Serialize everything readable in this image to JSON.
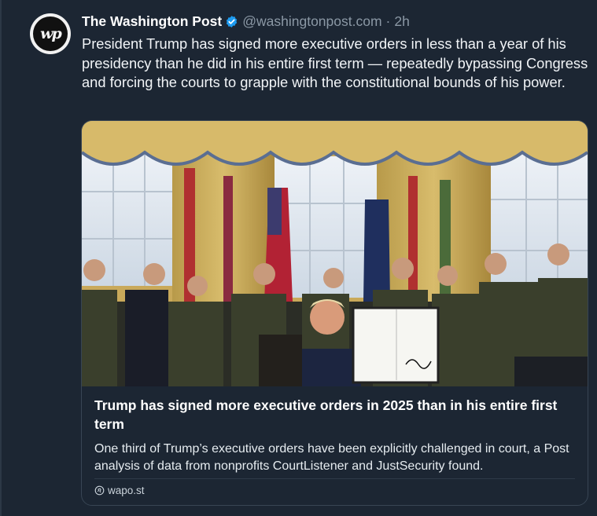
{
  "post": {
    "author_name": "The Washington Post",
    "handle": "@washingtonpost.com",
    "separator": "·",
    "time": "2h",
    "avatar_text": "wp",
    "text": "President Trump has signed more executive orders in less than a year of his presidency than he did in his entire first term — repeatedly bypassing Congress and forcing the courts to grapple with the constitutional bounds of his power."
  },
  "card": {
    "title": "Trump has signed more executive orders in 2025 than in his entire first term",
    "description": "One third of Trump’s executive orders have been explicitly challenged in court, a Post analysis of data from nonprofits CourtListener and JustSecurity found.",
    "link": "wapo.st"
  },
  "colors": {
    "background": "#1c2633",
    "verified_badge": "#1d9bf0",
    "muted_text": "#8b98a5"
  }
}
